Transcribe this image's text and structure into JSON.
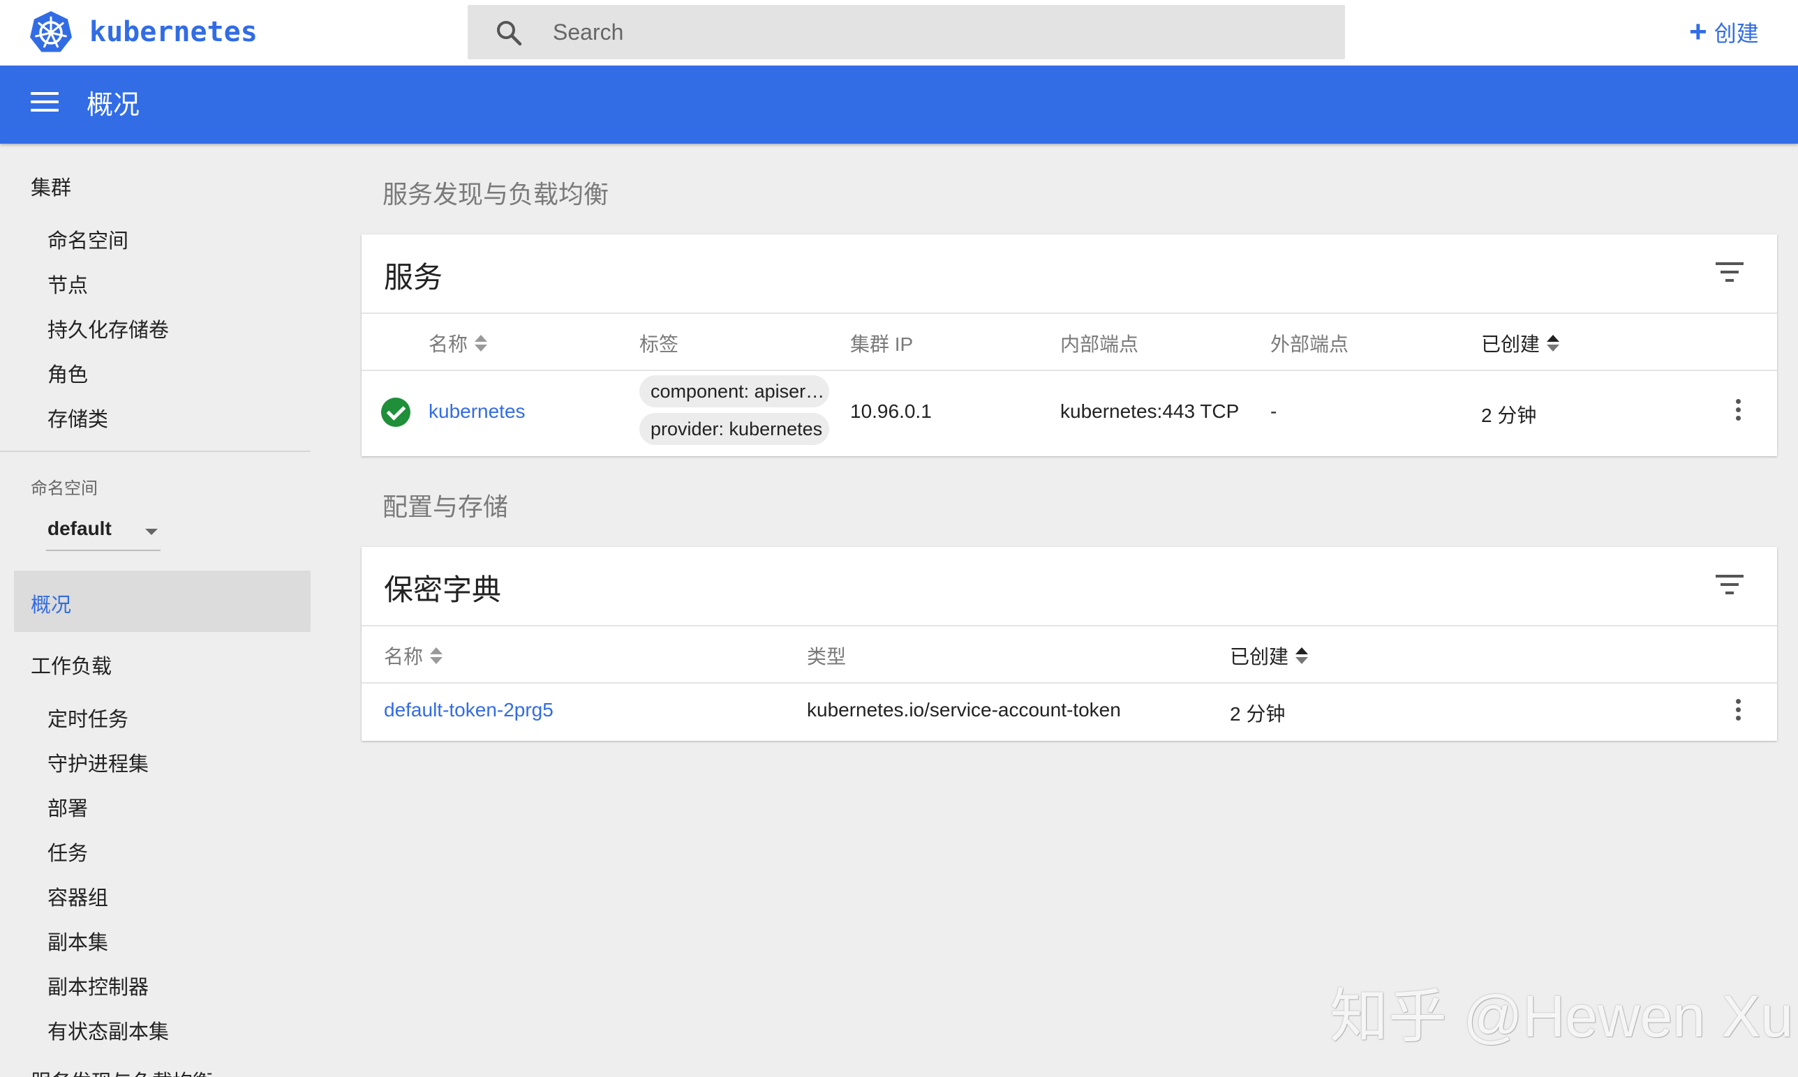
{
  "header": {
    "brand": "kubernetes",
    "search_placeholder": "Search",
    "create_label": "创建"
  },
  "titlebar": {
    "title": "概况"
  },
  "sidebar": {
    "cluster_group": "集群",
    "cluster_items": [
      "命名空间",
      "节点",
      "持久化存储卷",
      "角色",
      "存储类"
    ],
    "namespace_label": "命名空间",
    "namespace_value": "default",
    "active_item": "概况",
    "workload_group": "工作负载",
    "workload_items": [
      "定时任务",
      "守护进程集",
      "部署",
      "任务",
      "容器组",
      "副本集",
      "副本控制器",
      "有状态副本集"
    ],
    "discovery_group": "服务发现与负载均衡"
  },
  "main": {
    "discovery_section": "服务发现与负载均衡",
    "services_card": {
      "title": "服务",
      "columns": [
        "名称",
        "标签",
        "集群 IP",
        "内部端点",
        "外部端点",
        "已创建"
      ],
      "rows": [
        {
          "status": "ok",
          "name": "kubernetes",
          "labels": [
            "component: apiser…",
            "provider: kubernetes"
          ],
          "cluster_ip": "10.96.0.1",
          "internal_endpoint": "kubernetes:443 TCP",
          "external_endpoint": "-",
          "created": "2 分钟"
        }
      ]
    },
    "config_section": "配置与存储",
    "secrets_card": {
      "title": "保密字典",
      "columns": [
        "名称",
        "类型",
        "已创建"
      ],
      "rows": [
        {
          "name": "default-token-2prg5",
          "type": "kubernetes.io/service-account-token",
          "created": "2 分钟"
        }
      ]
    }
  },
  "watermark": "知乎 @Hewen Xu",
  "colors": {
    "brand": "#326ce5",
    "titlebar": "#326de6",
    "status_ok": "#1f8f3a"
  }
}
